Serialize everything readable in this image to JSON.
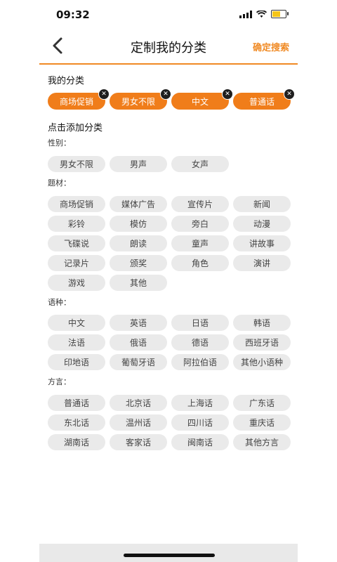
{
  "status": {
    "time": "09:32"
  },
  "header": {
    "title": "定制我的分类",
    "confirm": "确定搜索"
  },
  "my_categories": {
    "title": "我的分类",
    "items": [
      "商场促销",
      "男女不限",
      "中文",
      "普通话"
    ]
  },
  "add_title": "点击添加分类",
  "gender": {
    "label": "性别：",
    "items": [
      "男女不限",
      "男声",
      "女声"
    ]
  },
  "theme": {
    "label": "题材：",
    "items": [
      "商场促销",
      "媒体广告",
      "宣传片",
      "新闻",
      "彩铃",
      "模仿",
      "旁白",
      "动漫",
      "飞碟说",
      "朗读",
      "童声",
      "讲故事",
      "记录片",
      "颁奖",
      "角色",
      "演讲",
      "游戏",
      "其他"
    ]
  },
  "language": {
    "label": "语种：",
    "items": [
      "中文",
      "英语",
      "日语",
      "韩语",
      "法语",
      "俄语",
      "德语",
      "西班牙语",
      "印地语",
      "葡萄牙语",
      "阿拉伯语",
      "其他小语种"
    ]
  },
  "dialect": {
    "label": "方言：",
    "items": [
      "普通话",
      "北京话",
      "上海话",
      "广东话",
      "东北话",
      "温州话",
      "四川话",
      "重庆话",
      "湖南话",
      "客家话",
      "闽南话",
      "其他方言"
    ]
  },
  "colors": {
    "accent": "#f07d1a",
    "chip_bg": "#eaeaea"
  }
}
